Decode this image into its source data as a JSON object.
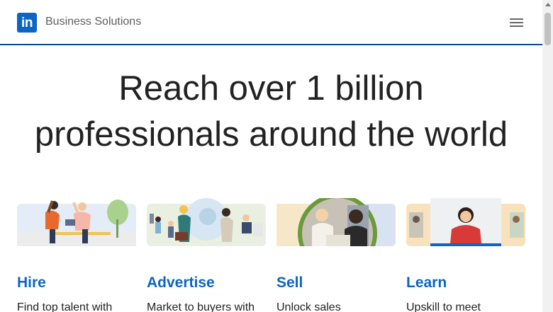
{
  "header": {
    "logo_text": "in",
    "brand": "Business Solutions",
    "menu_icon": "hamburger-menu-icon"
  },
  "hero": {
    "line1": "Reach over 1 billion",
    "line2": "professionals around the world"
  },
  "cards": [
    {
      "title": "Hire",
      "text": "Find top talent with",
      "icon": "people-high-five-illustration"
    },
    {
      "title": "Advertise",
      "text": "Market to buyers with",
      "icon": "presentation-illustration"
    },
    {
      "title": "Sell",
      "text": "Unlock sales",
      "icon": "meeting-photo-illustration"
    },
    {
      "title": "Learn",
      "text": "Upskill to meet",
      "icon": "learner-photo-illustration"
    }
  ],
  "colors": {
    "brand_blue": "#0a66c2",
    "header_border": "#0a4a86",
    "text": "#222222"
  }
}
